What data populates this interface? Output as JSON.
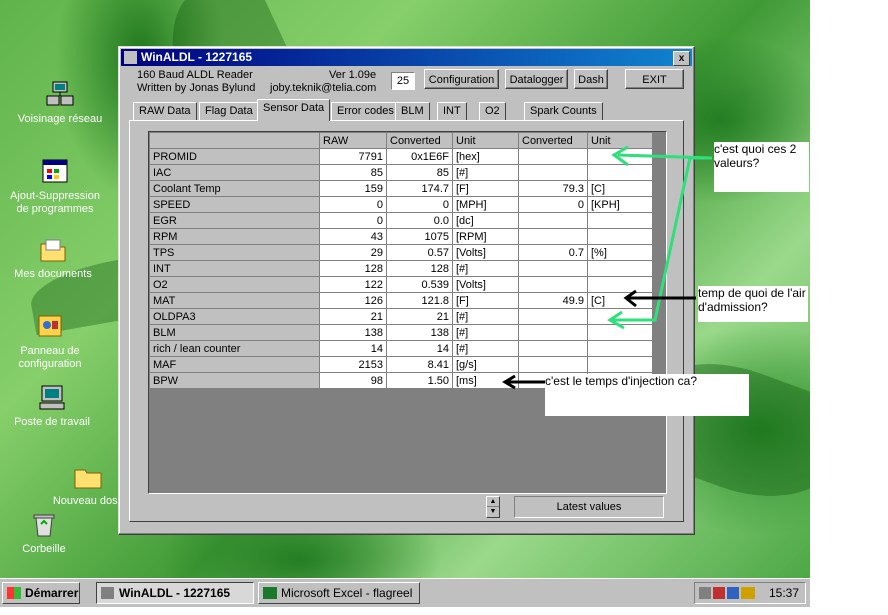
{
  "desktop": {
    "icons": [
      {
        "label": "Voisinage réseau",
        "icon": "network-neighborhood-icon"
      },
      {
        "label": "Ajout-Suppression de programmes",
        "icon": "add-remove-programs-icon"
      },
      {
        "label": "Mes documents",
        "icon": "folder-icon"
      },
      {
        "label": "Panneau de configuration",
        "icon": "control-panel-icon"
      },
      {
        "label": "Poste de travail",
        "icon": "computer-icon"
      },
      {
        "label": "Nouveau doss",
        "icon": "folder-icon"
      },
      {
        "label": "Corbeille",
        "icon": "recycle-bin-icon"
      }
    ]
  },
  "window": {
    "title": "WinALDL - 1227165",
    "close_label": "x",
    "header": {
      "line1": "160 Baud ALDL Reader",
      "line2": "Written by Jonas Bylund",
      "version": "Ver 1.09e",
      "email": "joby.teknik@telia.com",
      "counter": "25"
    },
    "buttons": {
      "configuration": "Configuration",
      "datalogger": "Datalogger",
      "dash": "Dash",
      "exit": "EXIT"
    },
    "tabs": [
      "RAW Data",
      "Flag Data",
      "Sensor Data",
      "Error codes",
      "BLM",
      "INT",
      "O2",
      "Spark Counts"
    ],
    "active_tab": "Sensor Data",
    "table": {
      "headers": [
        "",
        "RAW",
        "Converted",
        "Unit",
        "Converted",
        "Unit"
      ],
      "rows": [
        [
          "PROMID",
          "7791",
          "0x1E6F",
          "[hex]",
          "",
          ""
        ],
        [
          "IAC",
          "85",
          "85",
          "[#]",
          "",
          ""
        ],
        [
          "Coolant Temp",
          "159",
          "174.7",
          "[F]",
          "79.3",
          "[C]"
        ],
        [
          "SPEED",
          "0",
          "0",
          "[MPH]",
          "0",
          "[KPH]"
        ],
        [
          "EGR",
          "0",
          "0.0",
          "[dc]",
          "",
          ""
        ],
        [
          "RPM",
          "43",
          "1075",
          "[RPM]",
          "",
          ""
        ],
        [
          "TPS",
          "29",
          "0.57",
          "[Volts]",
          "0.7",
          "[%]"
        ],
        [
          "INT",
          "128",
          "128",
          "[#]",
          "",
          ""
        ],
        [
          "O2",
          "122",
          "0.539",
          "[Volts]",
          "",
          ""
        ],
        [
          "MAT",
          "126",
          "121.8",
          "[F]",
          "49.9",
          "[C]"
        ],
        [
          "OLDPA3",
          "21",
          "21",
          "[#]",
          "",
          ""
        ],
        [
          "BLM",
          "138",
          "138",
          "[#]",
          "",
          ""
        ],
        [
          "rich / lean counter",
          "14",
          "14",
          "[#]",
          "",
          ""
        ],
        [
          "MAF",
          "2153",
          "8.41",
          "[g/s]",
          "",
          ""
        ],
        [
          "BPW",
          "98",
          "1.50",
          "[ms]",
          "",
          ""
        ]
      ]
    },
    "status": "Latest values"
  },
  "annotations": {
    "note1": "c'est quoi ces 2 valeurs?",
    "note2": "temp de quoi de l'air d'admission?",
    "note3": "c'est le temps d'injection ca?",
    "green_arrow_color": "#2ee07a"
  },
  "taskbar": {
    "start": "Démarrer",
    "tasks": [
      "WinALDL - 1227165",
      "Microsoft Excel - flagreel"
    ],
    "clock": "15:37"
  }
}
